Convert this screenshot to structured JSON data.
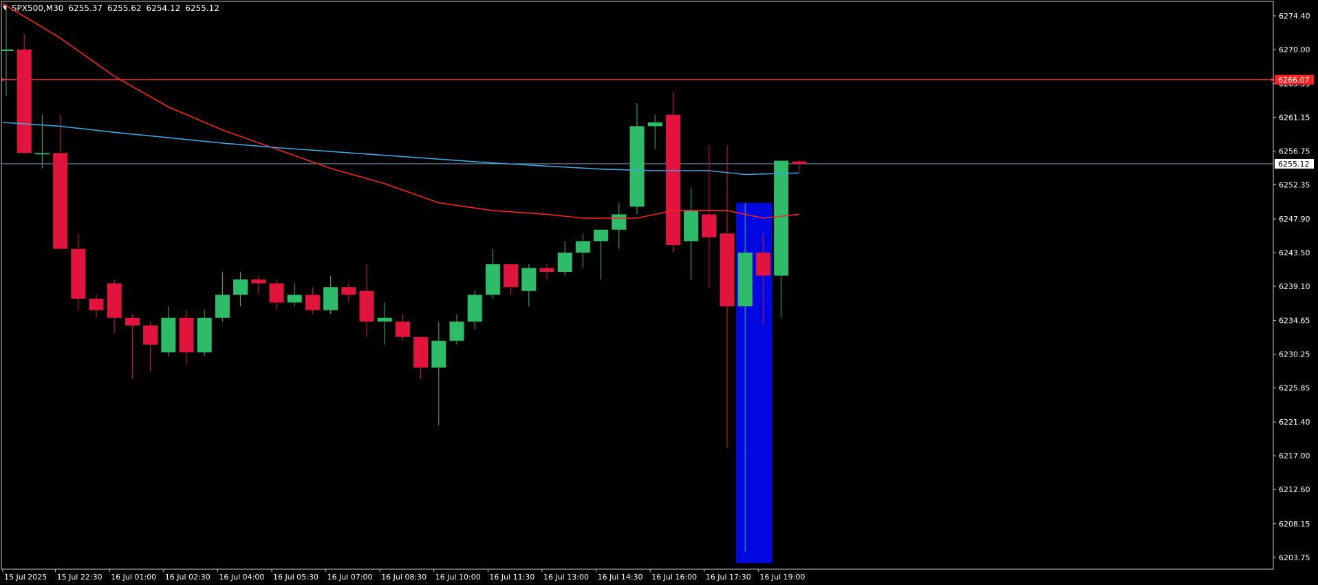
{
  "chart_data": {
    "type": "candlestick",
    "symbol": "SPX500,M30",
    "ohlc_header": {
      "open": "6255.37",
      "high": "6255.62",
      "low": "6254.12",
      "close": "6255.12"
    },
    "current_price_label": "6255.12",
    "level_line": {
      "value": 6266.07,
      "label": "6266.07"
    },
    "ylim": [
      6202.0,
      6277.0
    ],
    "y_ticks": [
      "6274.40",
      "6270.00",
      "6265.55",
      "6261.15",
      "6256.75",
      "6252.35",
      "6247.90",
      "6243.50",
      "6239.10",
      "6234.65",
      "6230.25",
      "6225.85",
      "6221.40",
      "6217.00",
      "6212.60",
      "6208.15",
      "6203.75"
    ],
    "x_ticks": [
      {
        "bar": 0,
        "label": "15 Jul 2025"
      },
      {
        "bar": 3,
        "label": "15 Jul 22:30"
      },
      {
        "bar": 6,
        "label": "16 Jul 01:00"
      },
      {
        "bar": 9,
        "label": "16 Jul 02:30"
      },
      {
        "bar": 12,
        "label": "16 Jul 04:00"
      },
      {
        "bar": 15,
        "label": "16 Jul 05:30"
      },
      {
        "bar": 18,
        "label": "16 Jul 07:00"
      },
      {
        "bar": 21,
        "label": "16 Jul 08:30"
      },
      {
        "bar": 24,
        "label": "16 Jul 10:00"
      },
      {
        "bar": 27,
        "label": "16 Jul 11:30"
      },
      {
        "bar": 30,
        "label": "16 Jul 13:00"
      },
      {
        "bar": 33,
        "label": "16 Jul 14:30"
      },
      {
        "bar": 36,
        "label": "16 Jul 16:00"
      },
      {
        "bar": 39,
        "label": "16 Jul 17:30"
      },
      {
        "bar": 42,
        "label": "16 Jul 19:00"
      }
    ],
    "bar_step": 26.2,
    "first_bar": 2,
    "candles": [
      {
        "o": 6270.0,
        "h": 6276.0,
        "l": 6264.0,
        "c": 6270.0
      },
      {
        "o": 6270.0,
        "h": 6272.0,
        "l": 6256.5,
        "c": 6256.5
      },
      {
        "o": 6256.5,
        "h": 6261.5,
        "l": 6254.5,
        "c": 6256.5
      },
      {
        "o": 6256.5,
        "h": 6261.5,
        "l": 6244.0,
        "c": 6244.0
      },
      {
        "o": 6244.0,
        "h": 6246.0,
        "l": 6236.0,
        "c": 6237.5
      },
      {
        "o": 6237.5,
        "h": 6238.0,
        "l": 6235.0,
        "c": 6236.0
      },
      {
        "o": 6239.5,
        "h": 6240.0,
        "l": 6233.0,
        "c": 6235.0
      },
      {
        "o": 6235.0,
        "h": 6235.5,
        "l": 6227.0,
        "c": 6234.0
      },
      {
        "o": 6234.0,
        "h": 6234.5,
        "l": 6228.0,
        "c": 6231.5
      },
      {
        "o": 6230.5,
        "h": 6236.5,
        "l": 6230.0,
        "c": 6235.0
      },
      {
        "o": 6235.0,
        "h": 6236.0,
        "l": 6229.0,
        "c": 6230.5
      },
      {
        "o": 6230.5,
        "h": 6236.0,
        "l": 6230.0,
        "c": 6235.0
      },
      {
        "o": 6235.0,
        "h": 6241.0,
        "l": 6234.5,
        "c": 6238.0
      },
      {
        "o": 6238.0,
        "h": 6241.0,
        "l": 6236.5,
        "c": 6240.0
      },
      {
        "o": 6240.0,
        "h": 6240.5,
        "l": 6238.0,
        "c": 6239.5
      },
      {
        "o": 6239.5,
        "h": 6240.0,
        "l": 6236.0,
        "c": 6237.0
      },
      {
        "o": 6237.0,
        "h": 6239.5,
        "l": 6236.5,
        "c": 6238.0
      },
      {
        "o": 6238.0,
        "h": 6239.0,
        "l": 6235.5,
        "c": 6236.0
      },
      {
        "o": 6236.0,
        "h": 6240.5,
        "l": 6235.5,
        "c": 6239.0
      },
      {
        "o": 6239.0,
        "h": 6239.5,
        "l": 6237.0,
        "c": 6238.0
      },
      {
        "o": 6238.5,
        "h": 6242.0,
        "l": 6232.5,
        "c": 6234.5
      },
      {
        "o": 6234.5,
        "h": 6237.0,
        "l": 6231.5,
        "c": 6235.0
      },
      {
        "o": 6234.5,
        "h": 6235.5,
        "l": 6232.0,
        "c": 6232.5
      },
      {
        "o": 6232.5,
        "h": 6232.5,
        "l": 6227.0,
        "c": 6228.5
      },
      {
        "o": 6228.5,
        "h": 6234.5,
        "l": 6221.0,
        "c": 6232.0
      },
      {
        "o": 6232.0,
        "h": 6235.5,
        "l": 6231.5,
        "c": 6234.5
      },
      {
        "o": 6234.5,
        "h": 6238.5,
        "l": 6233.5,
        "c": 6238.0
      },
      {
        "o": 6238.0,
        "h": 6244.0,
        "l": 6237.5,
        "c": 6242.0
      },
      {
        "o": 6242.0,
        "h": 6242.0,
        "l": 6238.0,
        "c": 6239.0
      },
      {
        "o": 6238.5,
        "h": 6242.0,
        "l": 6236.5,
        "c": 6241.5
      },
      {
        "o": 6241.5,
        "h": 6242.0,
        "l": 6240.0,
        "c": 6241.0
      },
      {
        "o": 6241.0,
        "h": 6245.0,
        "l": 6240.5,
        "c": 6243.5
      },
      {
        "o": 6243.5,
        "h": 6246.0,
        "l": 6241.5,
        "c": 6245.0
      },
      {
        "o": 6245.0,
        "h": 6246.5,
        "l": 6240.0,
        "c": 6246.5
      },
      {
        "o": 6246.5,
        "h": 6250.0,
        "l": 6244.0,
        "c": 6248.5
      },
      {
        "o": 6249.5,
        "h": 6263.0,
        "l": 6248.5,
        "c": 6260.0
      },
      {
        "o": 6260.0,
        "h": 6261.5,
        "l": 6257.0,
        "c": 6260.5
      },
      {
        "o": 6261.5,
        "h": 6264.5,
        "l": 6243.5,
        "c": 6244.5
      },
      {
        "o": 6245.0,
        "h": 6252.0,
        "l": 6240.0,
        "c": 6249.0
      },
      {
        "o": 6248.5,
        "h": 6257.5,
        "l": 6239.0,
        "c": 6245.5
      },
      {
        "o": 6246.0,
        "h": 6257.5,
        "l": 6218.0,
        "c": 6236.5
      },
      {
        "o": 6236.5,
        "h": 6250.0,
        "l": 6204.5,
        "c": 6243.5
      },
      {
        "o": 6243.5,
        "h": 6246.0,
        "l": 6234.0,
        "c": 6240.5
      },
      {
        "o": 6240.5,
        "h": 6255.5,
        "l": 6235.0,
        "c": 6255.5
      },
      {
        "o": 6255.4,
        "h": 6255.6,
        "l": 6254.1,
        "c": 6255.1
      }
    ],
    "highlight_box": {
      "from_bar": 40.5,
      "to_bar": 42.5,
      "top": 6250.0,
      "bottom": 6203.0,
      "color": "#0008e0"
    },
    "series": [
      {
        "color": "#ff2020",
        "points": [
          [
            -0.2,
            6276.0
          ],
          [
            3,
            6271.5
          ],
          [
            6,
            6266.5
          ],
          [
            9,
            6262.5
          ],
          [
            12,
            6259.5
          ],
          [
            15,
            6257.0
          ],
          [
            18,
            6254.5
          ],
          [
            21,
            6252.5
          ],
          [
            24,
            6250.0
          ],
          [
            27,
            6249.0
          ],
          [
            30,
            6248.5
          ],
          [
            32,
            6248.0
          ],
          [
            35,
            6248.0
          ],
          [
            37,
            6249.0
          ],
          [
            40,
            6249.0
          ],
          [
            42,
            6248.0
          ],
          [
            44,
            6248.5
          ]
        ]
      },
      {
        "color": "#3aa6e0",
        "points": [
          [
            -0.2,
            6260.5
          ],
          [
            3,
            6260.0
          ],
          [
            6,
            6259.2
          ],
          [
            9,
            6258.5
          ],
          [
            12,
            6257.8
          ],
          [
            15,
            6257.2
          ],
          [
            18,
            6256.7
          ],
          [
            21,
            6256.2
          ],
          [
            24,
            6255.7
          ],
          [
            27,
            6255.2
          ],
          [
            30,
            6254.8
          ],
          [
            33,
            6254.4
          ],
          [
            36,
            6254.2
          ],
          [
            39,
            6254.2
          ],
          [
            41,
            6253.7
          ],
          [
            44,
            6253.9
          ]
        ]
      }
    ],
    "colors": {
      "bull": "#2ebc6a",
      "bear": "#e0143c",
      "axis": "#c8c8c8",
      "bg": "#000000"
    }
  }
}
